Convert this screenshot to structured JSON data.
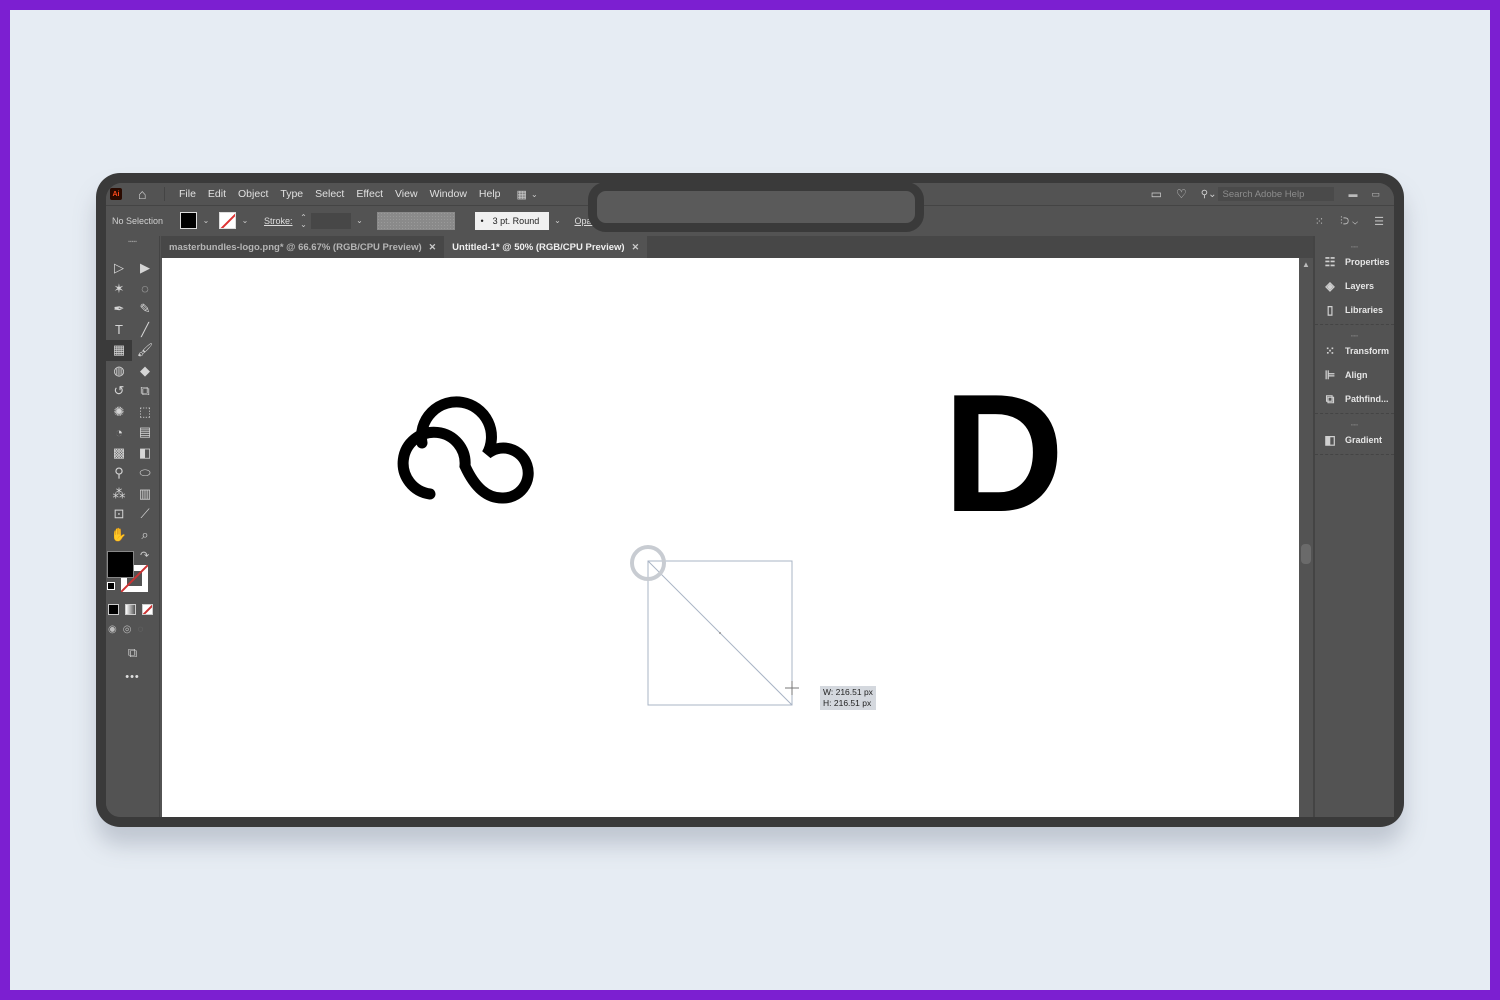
{
  "app": {
    "logo": "Ai",
    "menu": [
      "File",
      "Edit",
      "Object",
      "Type",
      "Select",
      "Effect",
      "View",
      "Window",
      "Help"
    ],
    "search_placeholder": "Search Adobe Help"
  },
  "controlbar": {
    "selection_status": "No Selection",
    "stroke_label": "Stroke:",
    "brush_value": "3 pt. Round",
    "opacity_label": "Opacity:"
  },
  "tabs": [
    {
      "label": "masterbundles-logo.png* @ 66.67% (RGB/CPU Preview)",
      "active": false
    },
    {
      "label": "Untitled-1* @ 50% (RGB/CPU Preview)",
      "active": true
    }
  ],
  "tools": [
    {
      "name": "selection-tool",
      "glyph": "▷"
    },
    {
      "name": "direct-selection-tool",
      "glyph": "▶"
    },
    {
      "name": "magic-wand-tool",
      "glyph": "✶"
    },
    {
      "name": "lasso-tool",
      "glyph": "◌"
    },
    {
      "name": "pen-tool",
      "glyph": "✒"
    },
    {
      "name": "curvature-tool",
      "glyph": "✎"
    },
    {
      "name": "type-tool",
      "glyph": "T"
    },
    {
      "name": "line-segment-tool",
      "glyph": "╱"
    },
    {
      "name": "rectangle-tool",
      "glyph": "▦"
    },
    {
      "name": "paintbrush-tool",
      "glyph": "🖌"
    },
    {
      "name": "shaper-tool",
      "glyph": "◍"
    },
    {
      "name": "eraser-tool",
      "glyph": "◆"
    },
    {
      "name": "rotate-tool",
      "glyph": "↺"
    },
    {
      "name": "scale-tool",
      "glyph": "⧉"
    },
    {
      "name": "warp-tool",
      "glyph": "✺"
    },
    {
      "name": "free-transform-tool",
      "glyph": "⬚"
    },
    {
      "name": "shape-builder-tool",
      "glyph": "◔"
    },
    {
      "name": "perspective-grid-tool",
      "glyph": "▤"
    },
    {
      "name": "mesh-tool",
      "glyph": "▩"
    },
    {
      "name": "gradient-tool",
      "glyph": "◧"
    },
    {
      "name": "eyedropper-tool",
      "glyph": "⚲"
    },
    {
      "name": "blend-tool",
      "glyph": "⬭"
    },
    {
      "name": "symbol-sprayer-tool",
      "glyph": "⁂"
    },
    {
      "name": "column-graph-tool",
      "glyph": "▥"
    },
    {
      "name": "artboard-tool",
      "glyph": "⊡"
    },
    {
      "name": "slice-tool",
      "glyph": "⟋"
    },
    {
      "name": "hand-tool",
      "glyph": "✋"
    },
    {
      "name": "zoom-tool",
      "glyph": "⌕"
    }
  ],
  "panels": {
    "group1": [
      "Properties",
      "Layers",
      "Libraries"
    ],
    "group2": [
      "Transform",
      "Align",
      "Pathfind..."
    ],
    "group3": [
      "Gradient"
    ]
  },
  "canvas": {
    "letter": "D",
    "measure_width": "W: 216.51 px",
    "measure_height": "H: 216.51 px"
  },
  "colors": {
    "frame": "#7c1fd1",
    "page": "#e6ecf3",
    "ui_dark": "#535353",
    "stroke_none": "#cc3333"
  }
}
